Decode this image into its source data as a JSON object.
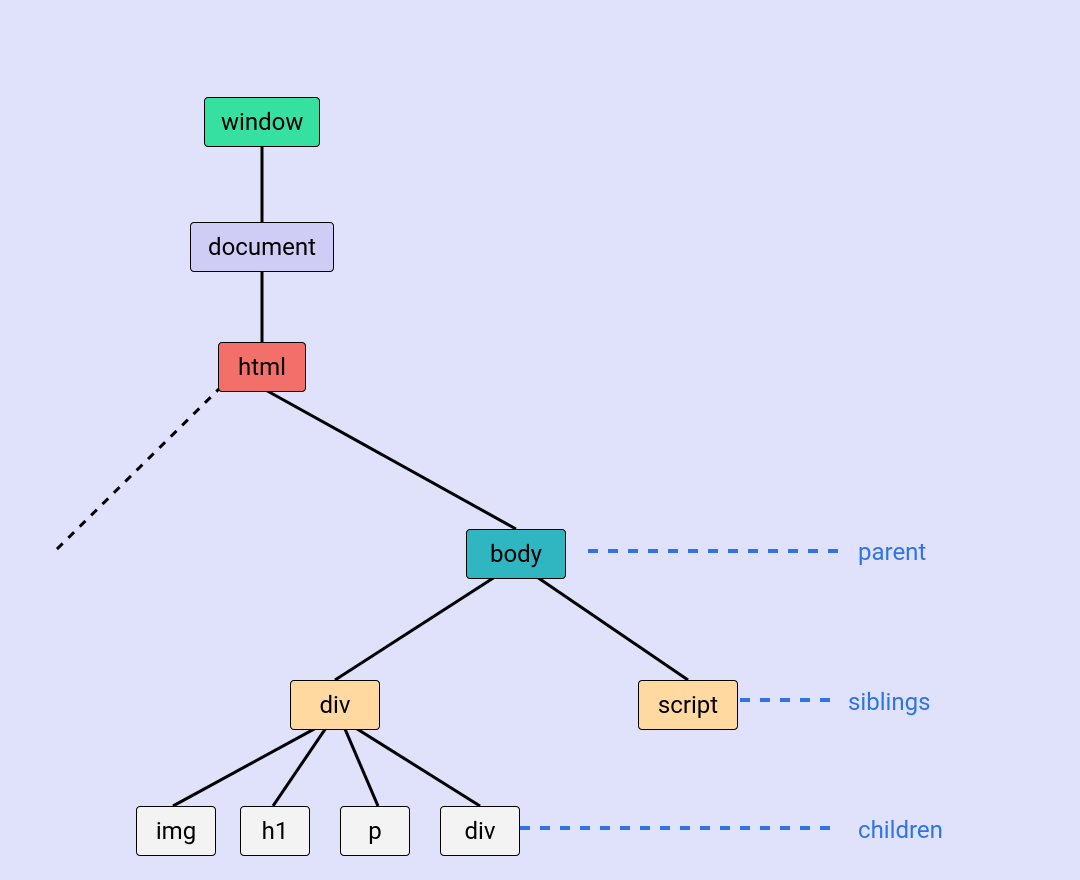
{
  "nodes": {
    "window": {
      "label": "window",
      "kind": "window"
    },
    "document": {
      "label": "document",
      "kind": "document"
    },
    "html": {
      "label": "html",
      "kind": "html"
    },
    "body": {
      "label": "body",
      "kind": "body"
    },
    "div": {
      "label": "div",
      "kind": "sibling"
    },
    "script": {
      "label": "script",
      "kind": "sibling"
    },
    "img": {
      "label": "img",
      "kind": "child"
    },
    "h1": {
      "label": "h1",
      "kind": "child"
    },
    "p": {
      "label": "p",
      "kind": "child"
    },
    "div2": {
      "label": "div",
      "kind": "child"
    }
  },
  "annotations": {
    "parent": "parent",
    "siblings": "siblings",
    "children": "children"
  },
  "colors": {
    "background": "#dfe2fa",
    "window": "#35e0a1",
    "document": "#cfcdf5",
    "html": "#f36f6a",
    "body": "#30b6c0",
    "sibling": "#ffd9a0",
    "child": "#f3f3f3",
    "annotation": "#2f74e6",
    "edge": "#000000"
  }
}
